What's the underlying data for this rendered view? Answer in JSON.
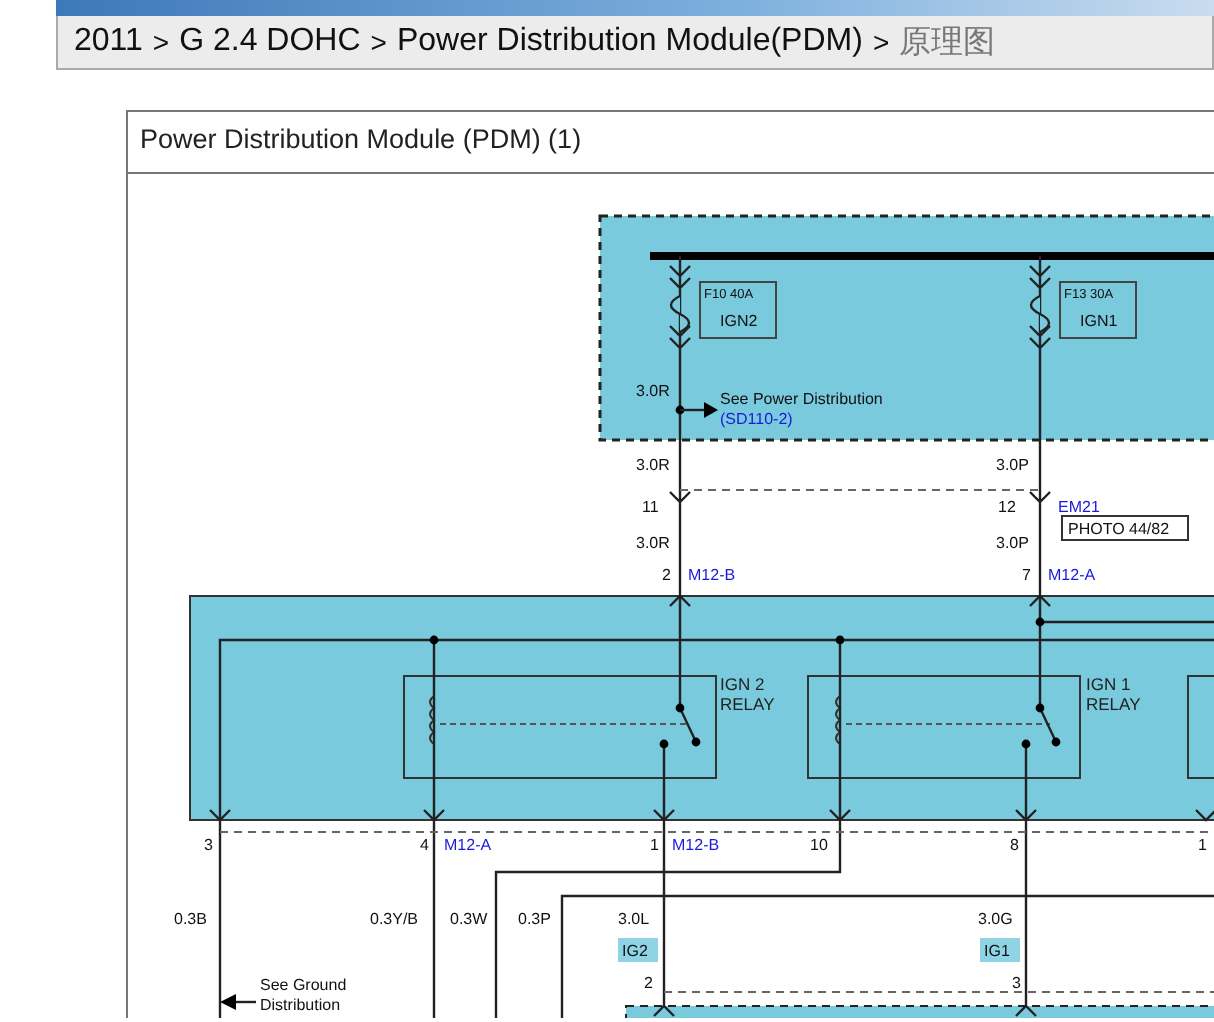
{
  "breadcrumb": {
    "separator": ">",
    "items": [
      "2011",
      "G 2.4 DOHC",
      "Power Distribution Module(PDM)",
      "原理图"
    ]
  },
  "diagram": {
    "title": "Power Distribution Module (PDM) (1)",
    "fuses": [
      {
        "rating": "F10 40A",
        "name": "IGN2"
      },
      {
        "rating": "F13 30A",
        "name": "IGN1"
      }
    ],
    "labels": [
      {
        "kind": "wire",
        "text": "3.0R"
      },
      {
        "kind": "note",
        "text": "See Power Distribution"
      },
      {
        "kind": "link",
        "text": "(SD110-2)"
      },
      {
        "kind": "wire",
        "text": "3.0R"
      },
      {
        "kind": "wire",
        "text": "3.0P"
      },
      {
        "kind": "pin",
        "text": "11"
      },
      {
        "kind": "pin",
        "text": "12"
      },
      {
        "kind": "connector",
        "text": "EM21"
      },
      {
        "kind": "photo",
        "text": "PHOTO 44/82"
      },
      {
        "kind": "wire",
        "text": "3.0R"
      },
      {
        "kind": "wire",
        "text": "3.0P"
      },
      {
        "kind": "pin",
        "text": "2"
      },
      {
        "kind": "connector",
        "text": "M12-B"
      },
      {
        "kind": "pin",
        "text": "7"
      },
      {
        "kind": "connector",
        "text": "M12-A"
      },
      {
        "kind": "relay",
        "lines": [
          "IGN 2",
          "RELAY"
        ]
      },
      {
        "kind": "relay",
        "lines": [
          "IGN 1",
          "RELAY"
        ]
      },
      {
        "kind": "pin",
        "text": "3"
      },
      {
        "kind": "pin",
        "text": "4"
      },
      {
        "kind": "connector",
        "text": "M12-A"
      },
      {
        "kind": "pin",
        "text": "1"
      },
      {
        "kind": "connector",
        "text": "M12-B"
      },
      {
        "kind": "pin",
        "text": "10"
      },
      {
        "kind": "pin",
        "text": "8"
      },
      {
        "kind": "pin",
        "text": "1"
      },
      {
        "kind": "wire",
        "text": "0.3B"
      },
      {
        "kind": "wire",
        "text": "0.3Y/B"
      },
      {
        "kind": "wire",
        "text": "0.3W"
      },
      {
        "kind": "wire",
        "text": "0.3P"
      },
      {
        "kind": "wire",
        "text": "3.0L"
      },
      {
        "kind": "wire",
        "text": "3.0G"
      },
      {
        "kind": "circuit",
        "text": "IG2"
      },
      {
        "kind": "circuit",
        "text": "IG1"
      },
      {
        "kind": "note",
        "lines": [
          "See Ground",
          "Distribution"
        ]
      },
      {
        "kind": "pin",
        "text": "2"
      },
      {
        "kind": "pin",
        "text": "3"
      }
    ]
  }
}
